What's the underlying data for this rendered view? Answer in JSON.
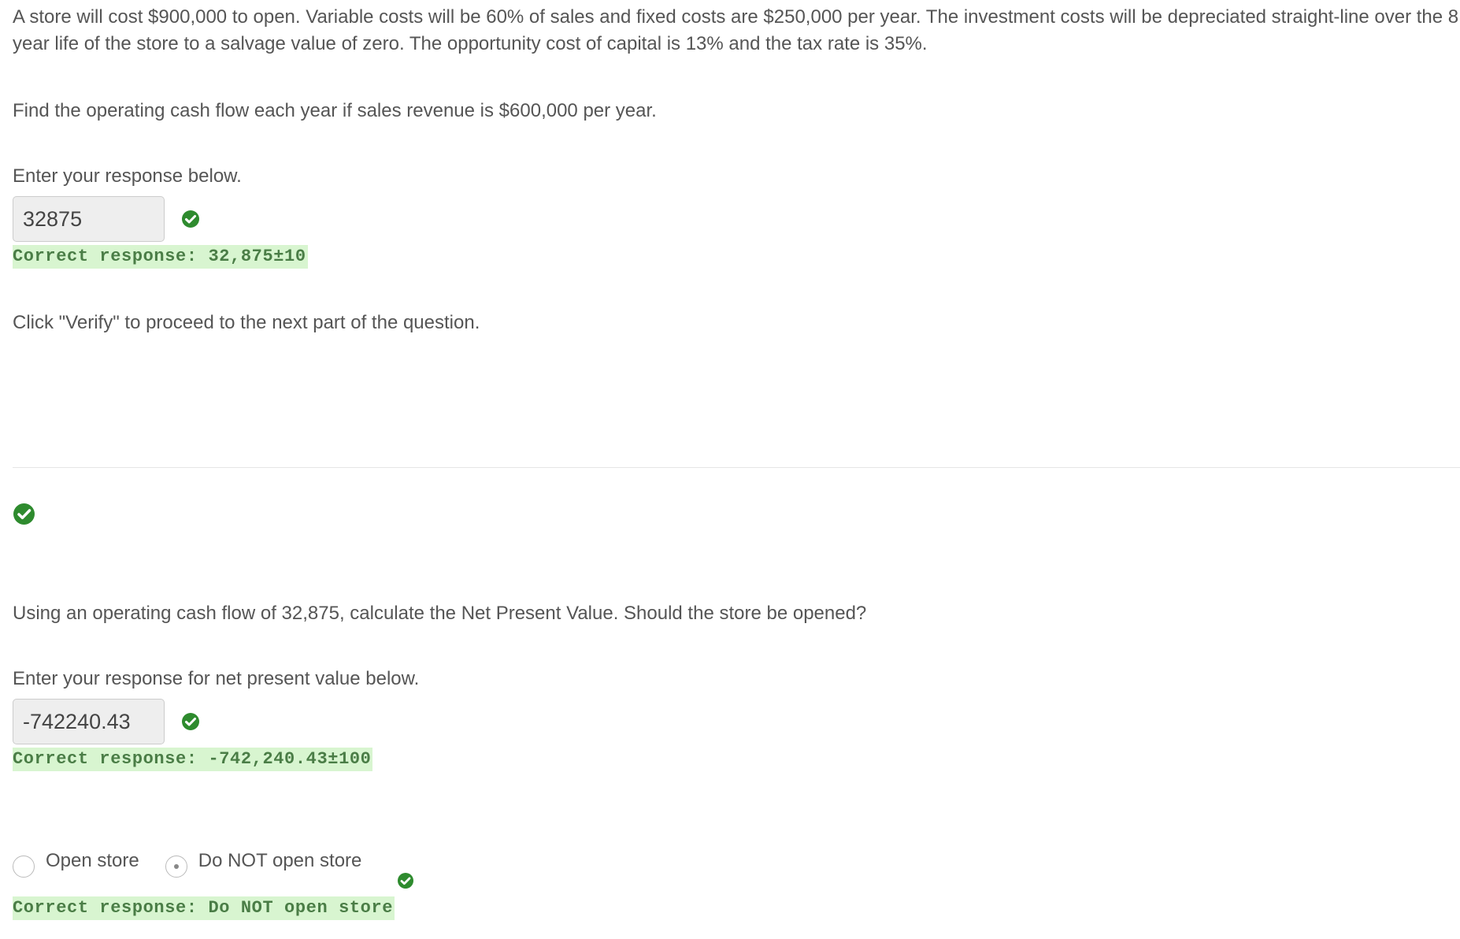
{
  "question": {
    "intro": "A store will cost $900,000 to open. Variable costs will be 60% of sales and fixed costs are $250,000 per year. The investment costs will be depreciated straight-line over the 8 year life of the store to a salvage value of zero. The opportunity cost of capital is 13% and the tax rate is 35%.",
    "part1_prompt": "Find the operating cash flow each year if sales revenue is $600,000 per year.",
    "part1_enter": "Enter your response below.",
    "part1_value": "32875",
    "part1_correct": "Correct response: 32,875±10",
    "verify_note": "Click \"Verify\" to proceed to the next part of the question.",
    "part2_prompt": "Using an operating cash flow of 32,875, calculate the Net Present Value. Should the store be opened?",
    "part2_enter": "Enter your response for net present value below.",
    "part2_value": "-742240.43",
    "part2_correct": "Correct response: -742,240.43±100",
    "options": [
      {
        "label": "Open store",
        "selected": false
      },
      {
        "label": "Do NOT open store",
        "selected": true
      }
    ],
    "part3_correct": "Correct response: Do NOT open store"
  },
  "icons": {
    "check": "check-circle-icon"
  },
  "colors": {
    "check_green": "#2e8b2e",
    "correct_bg": "#d8f5d0",
    "correct_text": "#4a7d46"
  }
}
